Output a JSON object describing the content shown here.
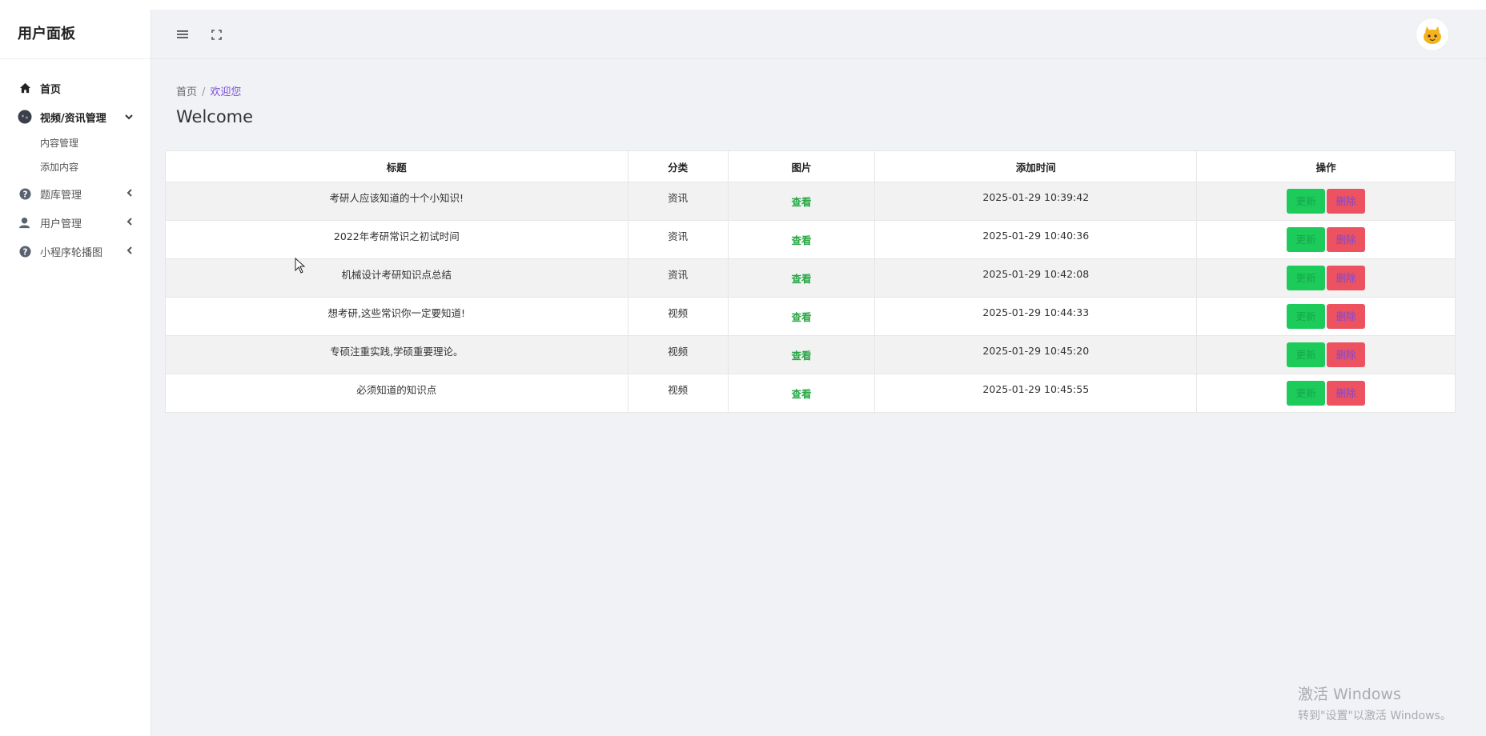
{
  "brand": "用户面板",
  "sidebar": {
    "items": [
      {
        "label": "首页",
        "icon": "home-icon"
      },
      {
        "label": "视频/资讯管理",
        "icon": "media-icon",
        "expanded": true,
        "children": [
          "内容管理",
          "添加内容"
        ]
      },
      {
        "label": "题库管理",
        "icon": "question-icon"
      },
      {
        "label": "用户管理",
        "icon": "user-icon"
      },
      {
        "label": "小程序轮播图",
        "icon": "question-icon"
      }
    ]
  },
  "header": {
    "menu_icon": "menu-icon",
    "fullscreen_icon": "fullscreen-icon"
  },
  "breadcrumb": {
    "home": "首页",
    "sep": "/",
    "current": "欢迎您"
  },
  "page_title": "Welcome",
  "table": {
    "headers": [
      "标题",
      "分类",
      "图片",
      "添加时间",
      "操作"
    ],
    "rows": [
      {
        "title": "考研人应该知道的十个小知识!",
        "category": "资讯",
        "image": "查看",
        "time": "2025-01-29 10:39:42",
        "update": "更新",
        "delete": "删除"
      },
      {
        "title": "2022年考研常识之初试时间",
        "category": "资讯",
        "image": "查看",
        "time": "2025-01-29 10:40:36",
        "update": "更新",
        "delete": "删除"
      },
      {
        "title": "机械设计考研知识点总结",
        "category": "资讯",
        "image": "查看",
        "time": "2025-01-29 10:42:08",
        "update": "更新",
        "delete": "删除"
      },
      {
        "title": "想考研,这些常识你一定要知道!",
        "category": "视频",
        "image": "查看",
        "time": "2025-01-29 10:44:33",
        "update": "更新",
        "delete": "删除"
      },
      {
        "title": "专硕注重实践,学硕重要理论。",
        "category": "视频",
        "image": "查看",
        "time": "2025-01-29 10:45:20",
        "update": "更新",
        "delete": "删除"
      },
      {
        "title": "必须知道的知识点",
        "category": "视频",
        "image": "查看",
        "time": "2025-01-29 10:45:55",
        "update": "更新",
        "delete": "删除"
      }
    ]
  },
  "watermark": {
    "line1": "激活 Windows",
    "line2": "转到\"设置\"以激活 Windows。"
  },
  "colors": {
    "update": "#1ccb5a",
    "delete": "#ec5260",
    "accent": "#7b4fd6",
    "link": "#28a745"
  }
}
